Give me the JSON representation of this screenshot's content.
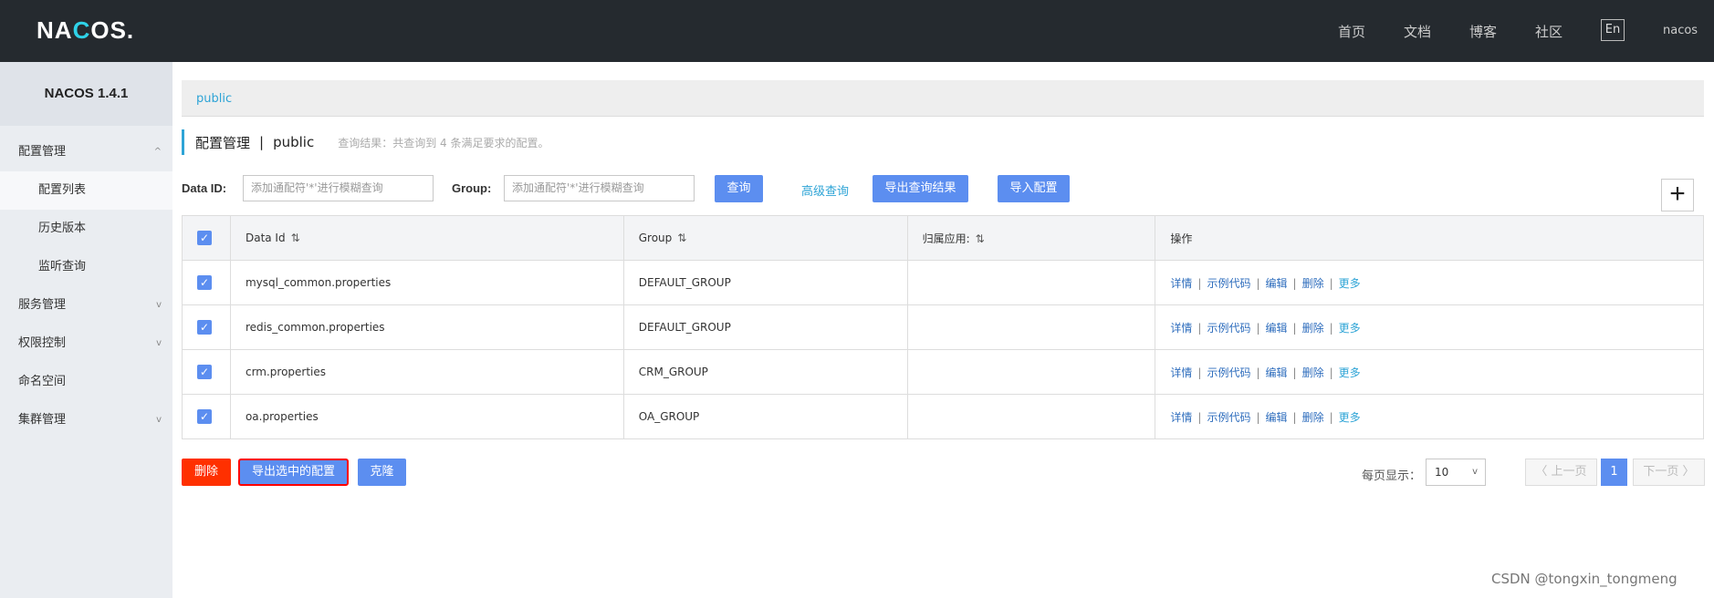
{
  "header": {
    "logo_left": "NA",
    "logo_c": "C",
    "logo_right": "OS.",
    "nav": [
      "首页",
      "文档",
      "博客",
      "社区"
    ],
    "lang": "En",
    "user": "nacos"
  },
  "sidebar": {
    "title": "NACOS 1.4.1",
    "groups": {
      "config": "配置管理",
      "config_list": "配置列表",
      "history": "历史版本",
      "listener": "监听查询",
      "service": "服务管理",
      "auth": "权限控制",
      "namespace": "命名空间",
      "cluster": "集群管理"
    },
    "chevron_up": "^",
    "chevron_down": "v"
  },
  "breadcrumb": "public",
  "title": {
    "main": "配置管理",
    "sep": "|",
    "namespace": "public",
    "hint": "查询结果：共查询到 4 条满足要求的配置。"
  },
  "search": {
    "dataid_label": "Data ID:",
    "dataid_placeholder": "添加通配符'*'进行模糊查询",
    "group_label": "Group:",
    "group_placeholder": "添加通配符'*'进行模糊查询",
    "query": "查询",
    "advanced": "高级查询",
    "export_result": "导出查询结果",
    "import": "导入配置",
    "add": "+"
  },
  "table": {
    "headers": {
      "dataid": "Data Id",
      "group": "Group",
      "app": "归属应用:",
      "ops": "操作"
    },
    "sort_icon": "⇅",
    "check": "✓",
    "rows": [
      {
        "dataid": "mysql_common.properties",
        "group": "DEFAULT_GROUP",
        "app": ""
      },
      {
        "dataid": "redis_common.properties",
        "group": "DEFAULT_GROUP",
        "app": ""
      },
      {
        "dataid": "crm.properties",
        "group": "CRM_GROUP",
        "app": ""
      },
      {
        "dataid": "oa.properties",
        "group": "OA_GROUP",
        "app": ""
      }
    ],
    "ops": {
      "detail": "详情",
      "sample": "示例代码",
      "edit": "编辑",
      "delete": "删除",
      "more": "更多",
      "bar": "|"
    }
  },
  "footer": {
    "delete": "删除",
    "export_selected": "导出选中的配置",
    "clone": "克隆",
    "page_size_label": "每页显示：",
    "page_size": "10",
    "prev": "〈 上一页",
    "page": "1",
    "next": "下一页 〉"
  },
  "watermark": "CSDN @tongxin_tongmeng",
  "colors": {
    "primary": "#5c8ef0",
    "danger": "#ff3000",
    "topbar": "#252a2f",
    "link": "#2ea4d6",
    "highlight": "#ff0000"
  }
}
